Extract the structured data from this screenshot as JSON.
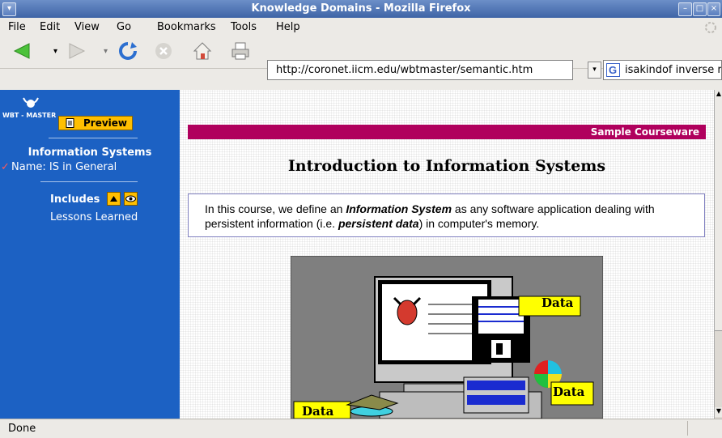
{
  "window": {
    "title": "Knowledge Domains - Mozilla Firefox"
  },
  "menu": [
    {
      "label": "File"
    },
    {
      "label": "Edit"
    },
    {
      "label": "View"
    },
    {
      "label": "Go"
    },
    {
      "label": "Bookmarks"
    },
    {
      "label": "Tools"
    },
    {
      "label": "Help"
    }
  ],
  "toolbar": {
    "url": "http://coronet.iicm.edu/wbtmaster/semantic.htm",
    "search_text": "isakindof inverse rel"
  },
  "sidebar": {
    "logo_label": "WBT - MASTER",
    "preview_label": "Preview",
    "section_title": "Information Systems",
    "name_item": "Name: IS in General",
    "includes_label": "Includes",
    "includes_item": "Lessons Learned"
  },
  "page": {
    "banner": "Sample Courseware",
    "heading": "Introduction to Information Systems",
    "intro_1": "In this course, we define an ",
    "intro_em1": "Information System",
    "intro_2": " as any software application dealing with persistent information (i.e. ",
    "intro_em2": "persistent data",
    "intro_3": ") in computer's memory.",
    "data_label": "Data"
  },
  "status": {
    "text": "Done"
  },
  "colors": {
    "sidebar": "#1c61c3",
    "banner": "#b0005d",
    "preview": "#ffbf00",
    "titlebar": "#3e64a6"
  }
}
